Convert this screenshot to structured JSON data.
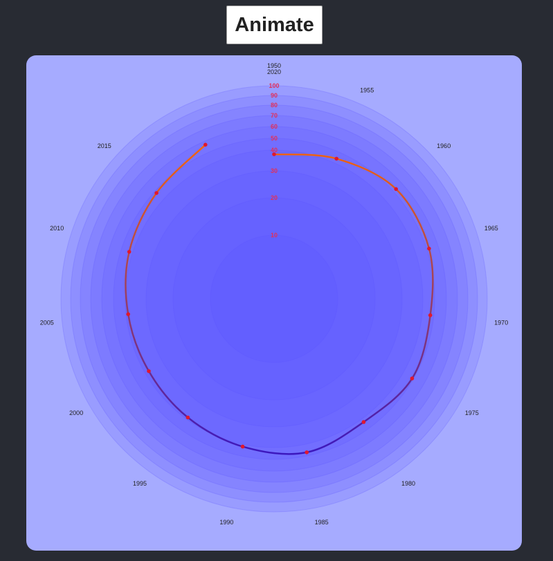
{
  "button": {
    "label": "Animate"
  },
  "colors": {
    "background": "#282b33",
    "panel": "#a6abff",
    "ring": "#5a55ff",
    "tick_label": "#e0305a",
    "point": "#e0182e",
    "line_start": "#ff6a00",
    "line_end": "#3214c8"
  },
  "chart_data": {
    "type": "line",
    "subtype": "radial",
    "categories": [
      "1950",
      "1955",
      "1960",
      "1965",
      "1970",
      "1975",
      "1980",
      "1985",
      "1990",
      "1995",
      "2000",
      "2005",
      "2010",
      "2015",
      "2020"
    ],
    "values": [
      38,
      44,
      53,
      52,
      47,
      49,
      43,
      47,
      42,
      39,
      38,
      39,
      43,
      48,
      57
    ],
    "r_ticks": [
      10,
      20,
      30,
      40,
      50,
      60,
      70,
      80,
      90,
      100
    ],
    "rlim": [
      0,
      100
    ],
    "closed": false,
    "grid": true,
    "title": "",
    "xlabel": "",
    "ylabel": ""
  }
}
